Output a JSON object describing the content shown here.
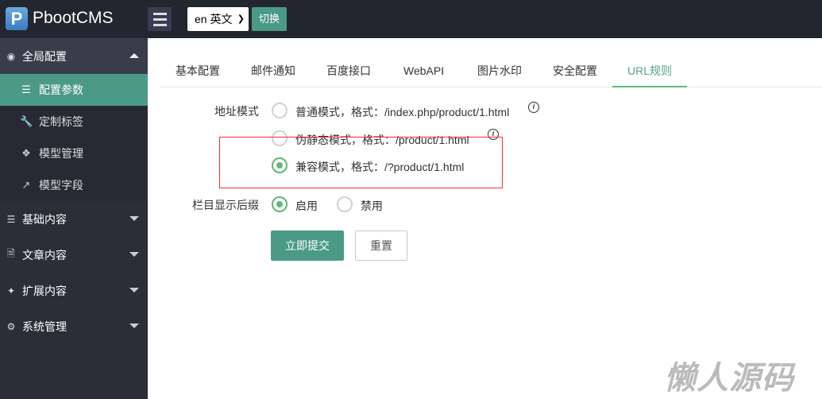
{
  "header": {
    "logo_letter": "P",
    "brand": "PbootCMS",
    "lang_select": "en 英文",
    "switch_label": "切换"
  },
  "sidebar": {
    "groups": [
      {
        "label": "全局配置",
        "icon": "globe-icon",
        "items": [
          {
            "label": "配置参数",
            "icon": "sliders-icon"
          },
          {
            "label": "定制标签",
            "icon": "wrench-icon"
          },
          {
            "label": "模型管理",
            "icon": "cube-icon"
          },
          {
            "label": "模型字段",
            "icon": "external-link-icon"
          }
        ]
      },
      {
        "label": "基础内容",
        "icon": "sliders-icon"
      },
      {
        "label": "文章内容",
        "icon": "file-icon"
      },
      {
        "label": "扩展内容",
        "icon": "puzzle-icon"
      },
      {
        "label": "系统管理",
        "icon": "gear-icon"
      }
    ]
  },
  "tabs": [
    "基本配置",
    "邮件通知",
    "百度接口",
    "WebAPI",
    "图片水印",
    "安全配置",
    "URL规则"
  ],
  "form": {
    "url_mode_label": "地址模式",
    "url_mode_options": [
      "普通模式，格式：/index.php/product/1.html",
      "伪静态模式，格式：/product/1.html",
      "兼容模式，格式：/?product/1.html"
    ],
    "url_mode_selected": 2,
    "suffix_label": "栏目显示后缀",
    "suffix_options": [
      "启用",
      "禁用"
    ],
    "suffix_selected": 0,
    "submit_label": "立即提交",
    "reset_label": "重置",
    "info_glyph": "i"
  },
  "watermark": "懒人源码"
}
